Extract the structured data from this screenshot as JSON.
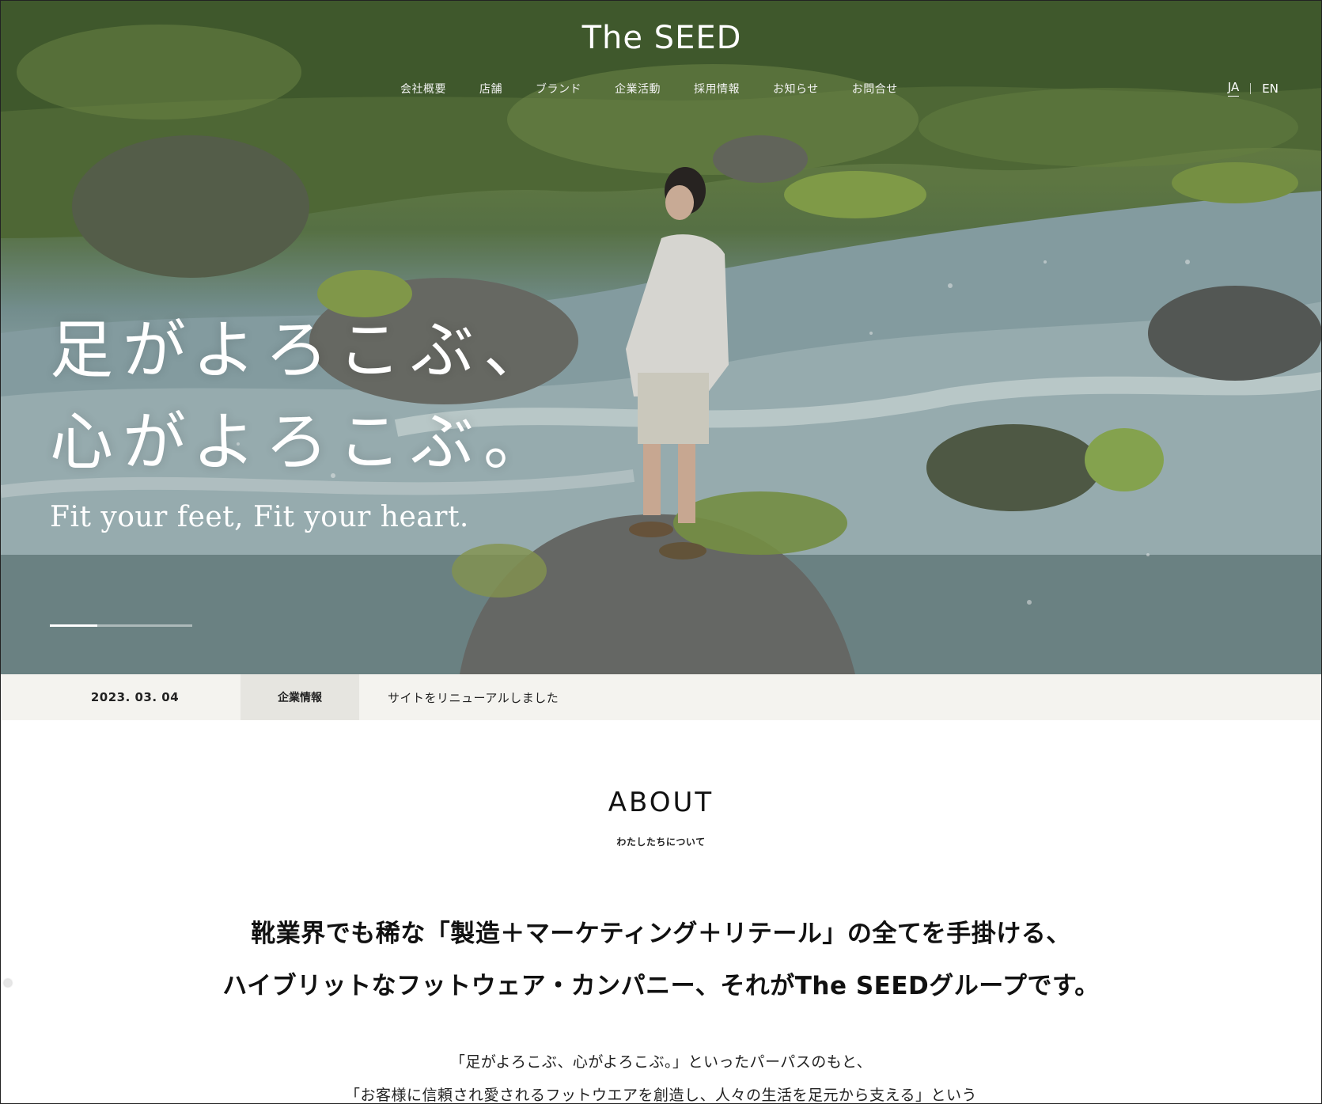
{
  "header": {
    "logo": "The SEED",
    "nav": [
      "会社概要",
      "店舗",
      "ブランド",
      "企業活動",
      "採用情報",
      "お知らせ",
      "お問合せ"
    ],
    "lang": {
      "ja": "JA",
      "en": "EN"
    }
  },
  "hero": {
    "title_line1": "足がよろこぶ、",
    "title_line2": "心がよろこぶ。",
    "subtitle": "Fit your feet, Fit your heart.",
    "slides_total": 3,
    "slide_active": 1
  },
  "news": {
    "date": "2023. 03. 04",
    "category": "企業情報",
    "title": "サイトをリニューアルしました"
  },
  "about": {
    "heading": "ABOUT",
    "subheading": "わたしたちについて",
    "lead_line1": "靴業界でも稀な「製造＋マーケティング＋リテール」の全てを手掛ける、",
    "lead_line2": "ハイブリットなフットウェア・カンパニー、それがThe SEEDグループです。",
    "body_line1": "「足がよろこぶ、心がよろこぶ。」といったパーパスのもと、",
    "body_line2": "「お客様に信頼され愛されるフットウエアを創造し、人々の生活を足元から支える」という"
  }
}
